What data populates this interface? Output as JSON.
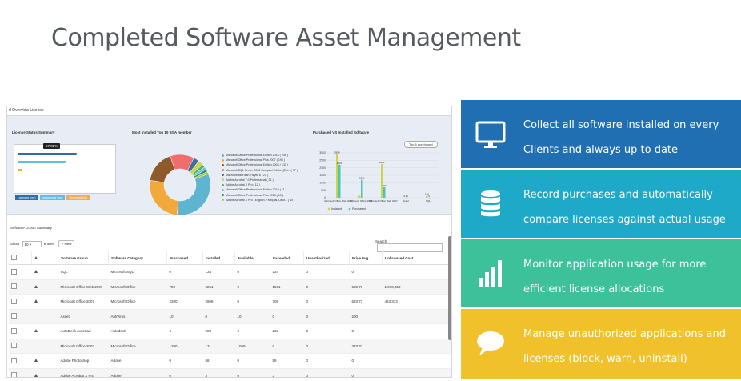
{
  "heading": "Completed Software Asset Management",
  "dashboard": {
    "window_title": "d Overview License",
    "license_status": {
      "label": "License Status Summary",
      "tooltip": "57.82%",
      "buttons": [
        "Licensed (xxx)",
        "Unlicensed (xxx)",
        "Exceeded (xx)"
      ]
    },
    "top10": {
      "label": "Most Installed Top 10 BSA member",
      "legend": [
        "Microsoft Office Professional Edition 2016 ( 246 )",
        "Microsoft Office Professional Plus 2007 ( 195 )",
        "Microsoft Office Professional Edition 2003 ( 131 )",
        "Microsoft SQL Server 2005 Compact Edition [EN... ( 97 )",
        "Macromedia Flash Player 8 ( 23 )",
        "Adobe Acrobat 7.0 Professional ( 21 )",
        "Adobe Acrobat X Pro ( 12 )",
        "Microsoft Office Professional Edition 2010 ( 11 )",
        "Microsoft Office Professional Plus 2013 ( 10 )",
        "Adobe Acrobat X Pro - English, Français, Deut... ( 10 )"
      ],
      "colors": [
        "#5fb4d0",
        "#f2a93b",
        "#8e5a2c",
        "#f06d6d",
        "#3a6ea5",
        "#c9d64c",
        "#49b27a",
        "#6bc4d6",
        "#2d8a5e",
        "#a6c83f"
      ]
    },
    "pvi": {
      "label": "Purchased VS Installed Software",
      "dropdown": "Top 5 purchased",
      "legend_installed": "Installed",
      "legend_purchased": "Purchased"
    },
    "group_summary_label": "Software Group Summary",
    "show_label": "Show",
    "entries_value": "10",
    "entries_label": "entries",
    "new_button": "+ New",
    "search_label": "Search:",
    "columns": [
      "Software Group",
      "Software Category",
      "Purchased",
      "Installed",
      "Available",
      "Exceeded",
      "Unauthorized",
      "Price Avg.",
      "Unlicensed Cost"
    ],
    "rows": [
      {
        "icon": true,
        "group": "SQL",
        "category": "Microsoft SQL",
        "purchased": "0",
        "installed": "134",
        "available": "0",
        "exceeded": "134",
        "unauthorized": "0",
        "price": "0",
        "cost": ""
      },
      {
        "icon": true,
        "group": "Microsoft Office Web 2007",
        "category": "Microsoft Office",
        "purchased": "700",
        "installed": "2261",
        "available": "0",
        "exceeded": "1561",
        "unauthorized": "0",
        "price": "685.71",
        "cost": "1,070,350"
      },
      {
        "icon": true,
        "group": "Microsoft Office 2007",
        "category": "Microsoft Office",
        "purchased": "2200",
        "installed": "2908",
        "available": "0",
        "exceeded": "708",
        "unauthorized": "0",
        "price": "683.73",
        "cost": "483,373"
      },
      {
        "icon": false,
        "group": "Asset",
        "category": "AntiVirus",
        "purchased": "10",
        "installed": "0",
        "available": "10",
        "exceeded": "0",
        "unauthorized": "0",
        "price": "200",
        "cost": ""
      },
      {
        "icon": true,
        "group": "AutoDesk AutoCad",
        "category": "Autodesk",
        "purchased": "0",
        "installed": "283",
        "available": "0",
        "exceeded": "283",
        "unauthorized": "0",
        "price": "0",
        "cost": ""
      },
      {
        "icon": false,
        "group": "Microsoft Office 2003",
        "category": "Microsoft Office",
        "purchased": "1200",
        "installed": "131",
        "available": "1069",
        "exceeded": "0",
        "unauthorized": "0",
        "price": "333.33",
        "cost": ""
      },
      {
        "icon": true,
        "group": "Adobe Photoshop",
        "category": "Adobe",
        "purchased": "0",
        "installed": "58",
        "available": "0",
        "exceeded": "58",
        "unauthorized": "0",
        "price": "0",
        "cost": ""
      },
      {
        "icon": true,
        "group": "Adobe Acrobat X Pro",
        "category": "Adobe",
        "purchased": "0",
        "installed": "3",
        "available": "0",
        "exceeded": "3",
        "unauthorized": "0",
        "price": "0",
        "cost": ""
      }
    ]
  },
  "chart_data": [
    {
      "type": "pie",
      "title": "Most Installed Top 10 BSA member",
      "labels": [
        "Microsoft Office Professional Edition 2016",
        "Microsoft Office Professional Plus 2007",
        "Microsoft Office Professional Edition 2003",
        "Microsoft SQL Server 2005 Compact Edition [EN...",
        "Macromedia Flash Player 8",
        "Adobe Acrobat 7.0 Professional",
        "Adobe Acrobat X Pro",
        "Microsoft Office Professional Edition 2010",
        "Microsoft Office Professional Plus 2013",
        "Adobe Acrobat X Pro - English, Français, Deut..."
      ],
      "values": [
        246,
        195,
        131,
        97,
        23,
        21,
        12,
        11,
        10,
        10
      ]
    },
    {
      "type": "bar",
      "title": "Purchased VS Installed Software",
      "categories": [
        "Microsoft Office Web 2007",
        "Microsoft Office 2003",
        "Microsoft Office Web 2007",
        "Asset",
        "SQL"
      ],
      "series": [
        {
          "name": "Installed",
          "values": [
            2908,
            131,
            2261,
            0,
            134
          ]
        },
        {
          "name": "Purchased",
          "values": [
            2200,
            1200,
            700,
            10,
            0
          ]
        }
      ],
      "data_labels": [
        [
          "2908",
          "2200"
        ],
        [
          "",
          "1200"
        ],
        [
          "2261",
          "700"
        ],
        [
          "0",
          "10"
        ],
        [
          "134",
          "0"
        ]
      ],
      "yticks": [
        "3000",
        "2500",
        "2000",
        "1500",
        "1000",
        "500",
        "0"
      ],
      "ylim": [
        0,
        3000
      ]
    }
  ],
  "features": [
    {
      "text": "Collect all software installed on every Clients and always up to date",
      "icon": "monitor-icon",
      "color": "#1f6fb2"
    },
    {
      "text": "Record purchases and automatically compare licenses against actual usage",
      "icon": "database-icon",
      "color": "#1fa9c9"
    },
    {
      "text": "Monitor application usage for more efficient license allocations",
      "icon": "bar-chart-icon",
      "color": "#3cc19a"
    },
    {
      "text": "Manage unauthorized applications and licenses (block, warn, uninstall)",
      "icon": "speech-bubble-icon",
      "color": "#f0c12a"
    }
  ]
}
